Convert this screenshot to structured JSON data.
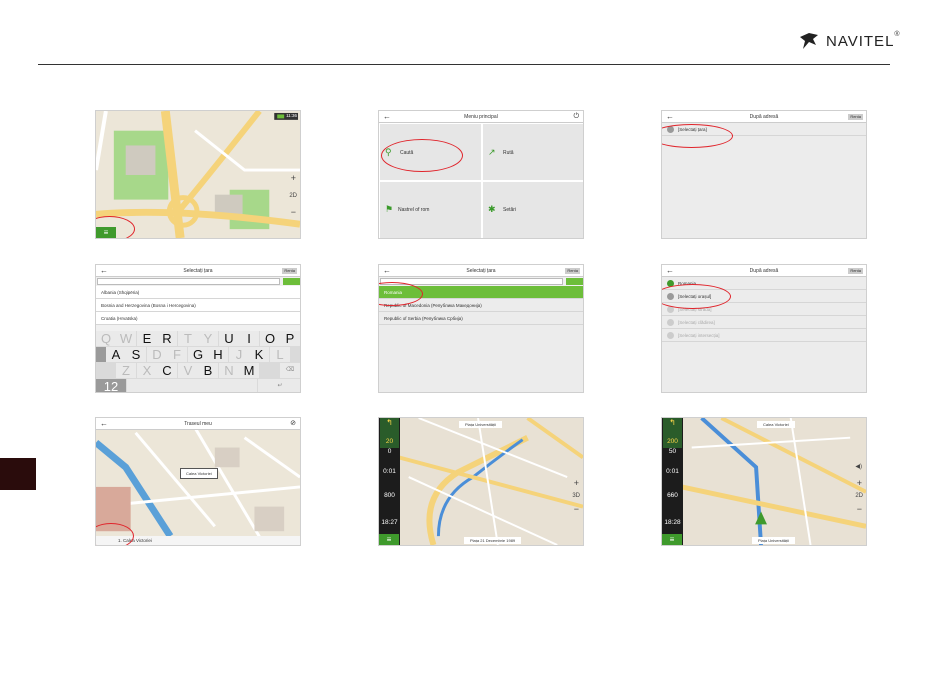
{
  "header": {
    "brand": "NAVITEL",
    "reg": "®"
  },
  "shot1": {
    "time": "11:36",
    "zoom_in": "+",
    "zoom_out": "−",
    "mode_2d": "2D",
    "menu_icon": "≡"
  },
  "shot2": {
    "title": "Meniu principal",
    "tiles": [
      "Caută",
      "Rută",
      "Nastrel of rom",
      "Setări"
    ]
  },
  "shot3": {
    "title": "După adresă",
    "rows": [
      "[Selectați țara]"
    ],
    "right_btn": "Renta"
  },
  "shot4": {
    "title": "Selectați țara",
    "right_btn": "Renta",
    "rows": [
      "Albania (Shqipëria)",
      "Bosnia and Herzegovina (Bosna i Hercegovina)",
      "Croatia (Hrvatska)"
    ],
    "keys_row1": [
      "Q",
      "W",
      "E",
      "R",
      "T",
      "Y",
      "U",
      "I",
      "O",
      "P"
    ],
    "keys_row2": [
      "A",
      "S",
      "D",
      "F",
      "G",
      "H",
      "J",
      "K",
      "L"
    ],
    "keys_row3": [
      "Z",
      "X",
      "C",
      "V",
      "B",
      "N",
      "M"
    ],
    "num_key": "12"
  },
  "shot5": {
    "title": "Selectați țara",
    "right_btn": "Renta",
    "rows": [
      "Romania",
      "Republic of Macedonia (Република Македонија)",
      "Republic of Serbia (Република Србија)"
    ]
  },
  "shot6": {
    "title": "După adresă",
    "right_btn": "Renta",
    "rows": [
      "Romania",
      "[Selectați orașul]",
      "[Selectați strada]",
      "[Selectați clădirea]",
      "[Selectați intersecția]"
    ]
  },
  "shot7": {
    "title": "Traseul meu",
    "label": "Calea Victoriei",
    "bottom": "1. Calea Victoriei"
  },
  "shot8": {
    "dist_top": "20",
    "dist_top_unit": "m",
    "v1": "0",
    "v2": "0:01",
    "v3": "800",
    "time": "18:27",
    "street_top": "Piața Universității",
    "street_bottom": "Piața 21 Decembrie 1989",
    "labels": [
      "Bulevardul Regina Elisabeta",
      "Strada Doamnei",
      "Strada Lipscani",
      "Strada Șelari",
      "Strada Gabroveni",
      "Strada Franceză",
      "Strada Iuliu Maniu"
    ]
  },
  "shot9": {
    "dist_top": "200",
    "dist_top_unit": "m",
    "v1": "50",
    "v2": "0:01",
    "v3": "660",
    "time": "18:28",
    "street_top": "Calea Victoriei",
    "street_bottom": "Piața Universității",
    "labels": [
      "Strada Academiei",
      "Bulevardul Regina Elisabeta",
      "Bulevardul Carol I"
    ]
  }
}
